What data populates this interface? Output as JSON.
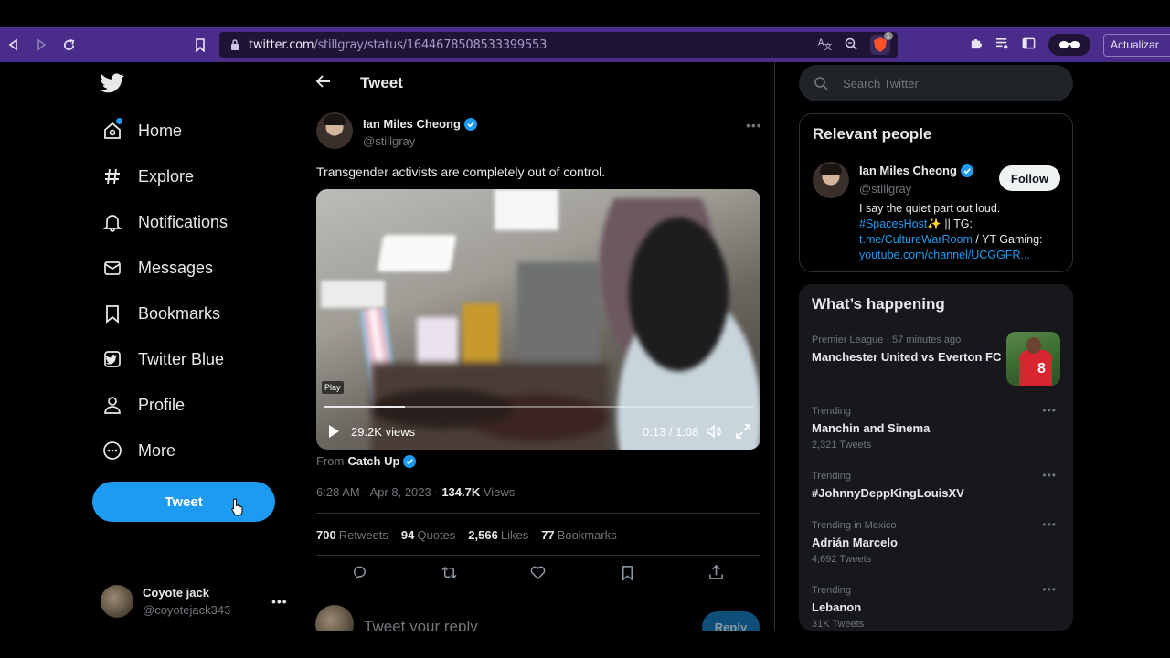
{
  "browser": {
    "url_domain": "twitter.com",
    "url_path": "/stillgray/status/1644678508533399553",
    "shield_count": "1",
    "update_label": "Actualizar"
  },
  "sidebar": {
    "items": [
      {
        "label": "Home",
        "icon": "home-icon"
      },
      {
        "label": "Explore",
        "icon": "hashtag-icon"
      },
      {
        "label": "Notifications",
        "icon": "bell-icon"
      },
      {
        "label": "Messages",
        "icon": "envelope-icon"
      },
      {
        "label": "Bookmarks",
        "icon": "bookmark-icon"
      },
      {
        "label": "Twitter Blue",
        "icon": "twitter-blue-icon"
      },
      {
        "label": "Profile",
        "icon": "person-icon"
      },
      {
        "label": "More",
        "icon": "more-circle-icon"
      }
    ],
    "tweet_button": "Tweet",
    "account": {
      "name": "Coyote jack",
      "handle": "@coyotejack343"
    }
  },
  "main": {
    "title": "Tweet",
    "author": {
      "name": "Ian Miles Cheong",
      "handle": "@stillgray"
    },
    "text": "Transgender activists are completely out of control.",
    "video": {
      "play_label": "Play",
      "views": "29.2K views",
      "time": "0:13 / 1:08",
      "progress": 0.19
    },
    "from_label": "From",
    "from_source": "Catch Up",
    "timestamp": "6:28 AM · Apr 8, 2023 · ",
    "views_count": "134.7K",
    "views_label": " Views",
    "stats": [
      {
        "value": "700",
        "label": "Retweets"
      },
      {
        "value": "94",
        "label": "Quotes"
      },
      {
        "value": "2,566",
        "label": "Likes"
      },
      {
        "value": "77",
        "label": "Bookmarks"
      }
    ],
    "reply_placeholder": "Tweet your reply",
    "reply_button": "Reply"
  },
  "right": {
    "search_placeholder": "Search Twitter",
    "relevant": {
      "title": "Relevant people",
      "name": "Ian Miles Cheong",
      "handle": "@stillgray",
      "follow_label": "Follow",
      "bio_1": "I say the quiet part out loud.",
      "bio_tag": "#SpacesHost",
      "bio_emoji": "✨",
      "bio_2": " || TG:",
      "bio_link1": "t.me/CultureWarRoom",
      "bio_3": " / YT Gaming:",
      "bio_link2": "youtube.com/channel/UCGGFR..."
    },
    "happening": {
      "title": "What’s happening",
      "trends": [
        {
          "context": "Premier League · 57 minutes ago",
          "title": "Manchester United vs Everton FC",
          "count": ""
        },
        {
          "context": "Trending",
          "title": "Manchin and Sinema",
          "count": "2,321 Tweets"
        },
        {
          "context": "Trending",
          "title": "#JohnnyDeppKingLouisXV",
          "count": ""
        },
        {
          "context": "Trending in Mexico",
          "title": "Adrián Marcelo",
          "count": "4,692 Tweets"
        },
        {
          "context": "Trending",
          "title": "Lebanon",
          "count": "31K Tweets"
        }
      ]
    }
  },
  "colors": {
    "accent": "#1d9bf0",
    "browser_toolbar": "#4a2c8a",
    "background": "#000000",
    "panel": "#16181c"
  }
}
